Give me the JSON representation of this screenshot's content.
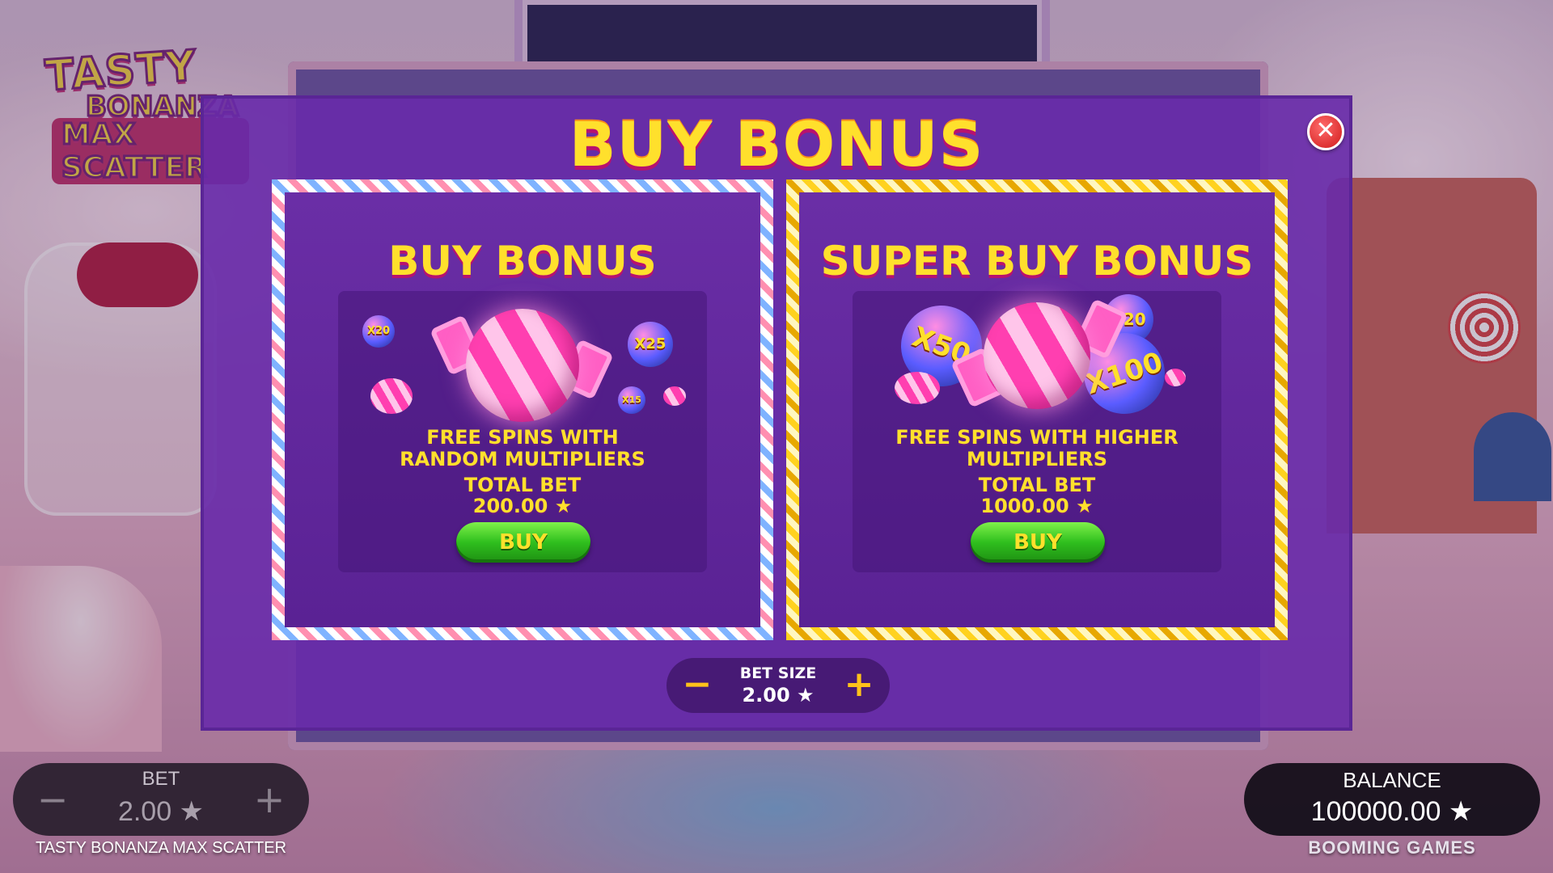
{
  "game": {
    "logo_line1": "TASTY",
    "logo_line2": "BONANZA",
    "logo_line3": "MAX SCATTER",
    "name": "TASTY BONANZA MAX SCATTER",
    "brand": "BOOMING GAMES"
  },
  "modal": {
    "title": "BUY BONUS",
    "close_label": "✕",
    "cards": [
      {
        "title": "BUY BONUS",
        "description_line1": "FREE SPINS WITH",
        "description_line2": "RANDOM MULTIPLIERS",
        "total_bet_label": "TOTAL BET",
        "total_bet_value": "200.00 ★",
        "buy_label": "BUY",
        "multipliers": [
          "X20",
          "X25",
          "X15"
        ]
      },
      {
        "title": "SUPER BUY BONUS",
        "description_line1": "FREE SPINS WITH HIGHER",
        "description_line2": "MULTIPLIERS",
        "total_bet_label": "TOTAL BET",
        "total_bet_value": "1000.00 ★",
        "buy_label": "BUY",
        "multipliers": [
          "X50",
          "X20",
          "X100"
        ]
      }
    ],
    "bet_size": {
      "label": "BET SIZE",
      "value": "2.00 ★",
      "minus": "−",
      "plus": "+"
    }
  },
  "hud": {
    "bet_label": "BET",
    "bet_value": "2.00 ★",
    "bet_minus": "−",
    "bet_plus": "+",
    "balance_label": "BALANCE",
    "balance_value": "100000.00 ★"
  },
  "colors": {
    "title_yellow": "#ffe02c",
    "modal_purple": "#682aaa",
    "buy_green": "#2fbf1e"
  }
}
